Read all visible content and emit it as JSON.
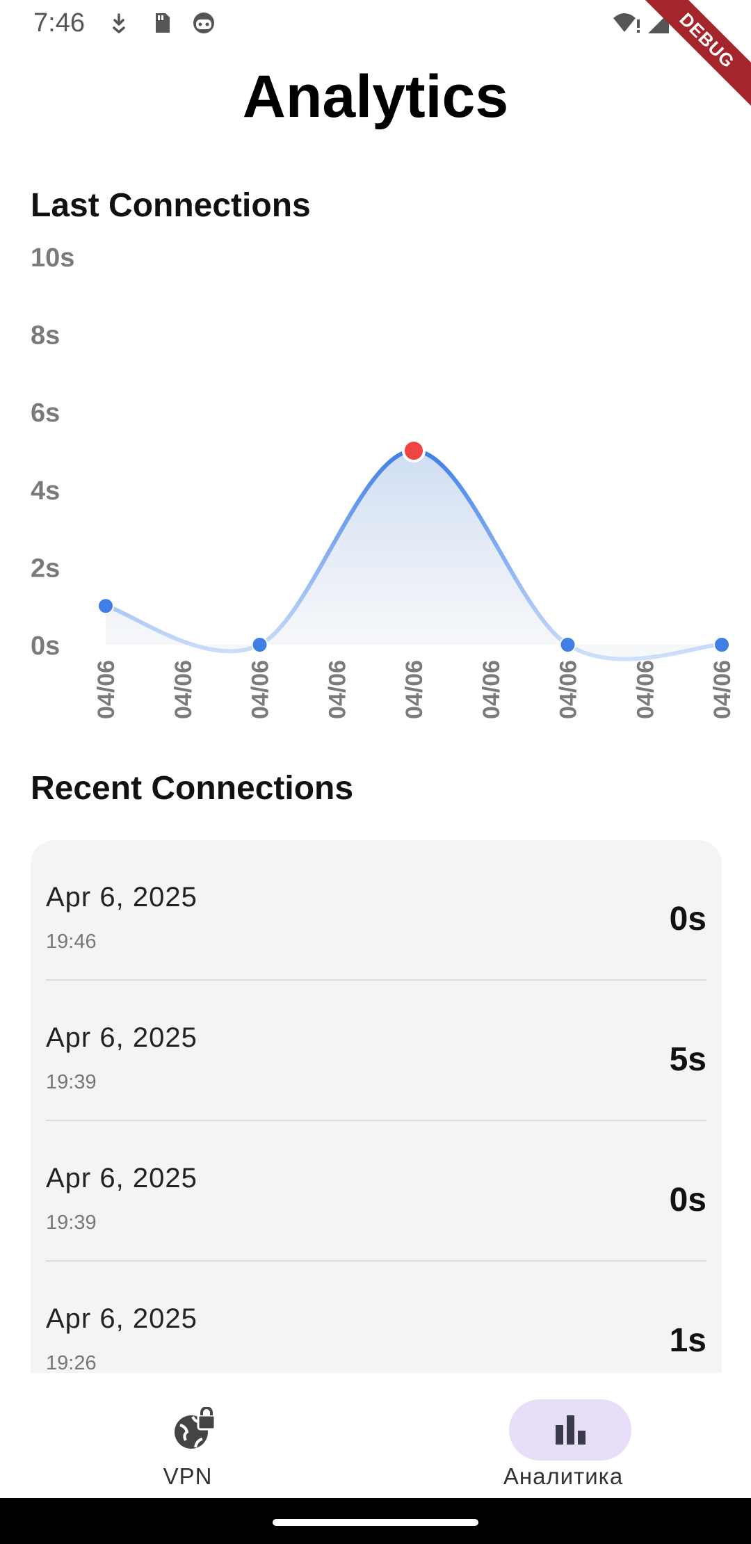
{
  "status_bar": {
    "time": "7:46",
    "icons": [
      "download-arrow-icon",
      "sd-card-icon",
      "android-face-icon",
      "wifi-alert-icon",
      "cell-signal-icon"
    ],
    "debug_banner": "DEBUG"
  },
  "page": {
    "title": "Analytics"
  },
  "chart_section": {
    "title": "Last Connections"
  },
  "chart_data": {
    "type": "line",
    "title": "",
    "xlabel": "",
    "ylabel": "",
    "y_unit": "s",
    "ylim": [
      0,
      10
    ],
    "y_ticks": [
      "0s",
      "2s",
      "4s",
      "6s",
      "8s",
      "10s"
    ],
    "x_tick_labels": [
      "04/06",
      "04/06",
      "04/06",
      "04/06",
      "04/06",
      "04/06",
      "04/06",
      "04/06",
      "04/06"
    ],
    "points": [
      {
        "x_index": 0,
        "value": 1,
        "highlight": false
      },
      {
        "x_index": 2,
        "value": 0,
        "highlight": false
      },
      {
        "x_index": 4,
        "value": 5,
        "highlight": true
      },
      {
        "x_index": 6,
        "value": 0,
        "highlight": false
      },
      {
        "x_index": 8,
        "value": 0,
        "highlight": false
      }
    ],
    "smooth": true,
    "area_fill": true,
    "grid": false,
    "colors": {
      "line": "#4a86e8",
      "point": "#3f7fe6",
      "highlight_point": "#ef4444",
      "axis_text": "#7a7a7a"
    }
  },
  "recent_section": {
    "title": "Recent Connections",
    "rows": [
      {
        "date": "Apr 6, 2025",
        "time": "19:46",
        "duration": "0s"
      },
      {
        "date": "Apr 6, 2025",
        "time": "19:39",
        "duration": "5s"
      },
      {
        "date": "Apr 6, 2025",
        "time": "19:39",
        "duration": "0s"
      },
      {
        "date": "Apr 6, 2025",
        "time": "19:26",
        "duration": "1s"
      }
    ]
  },
  "bottom_nav": {
    "items": [
      {
        "label": "VPN",
        "icon": "globe-lock-icon",
        "active": false
      },
      {
        "label": "Аналитика",
        "icon": "bar-chart-icon",
        "active": true
      }
    ],
    "active_pill_color": "#e8def8"
  }
}
